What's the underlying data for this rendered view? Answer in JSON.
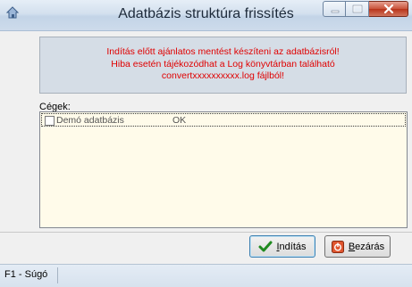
{
  "window": {
    "title": "Adatbázis struktúra frissítés"
  },
  "info": {
    "line1": "Indítás előtt ajánlatos mentést készíteni az adatbázisról!",
    "line2": "Hiba esetén tájékozódhat a Log könyvtárban található",
    "line3": "convertxxxxxxxxxx.log fájlból!"
  },
  "companies": {
    "label": "Cégek:",
    "rows": [
      {
        "name": "Demó adatbázis",
        "status": "OK",
        "checked": false
      }
    ]
  },
  "buttons": {
    "start": {
      "label": "Indítás",
      "icon": "green-check-icon"
    },
    "close": {
      "label": "Bezárás",
      "icon": "exit-icon"
    }
  },
  "statusbar": {
    "help": "F1 - Súgó"
  },
  "colors": {
    "warning_text": "#e00000",
    "list_background": "#fffbea",
    "info_background": "#d5dde6"
  }
}
